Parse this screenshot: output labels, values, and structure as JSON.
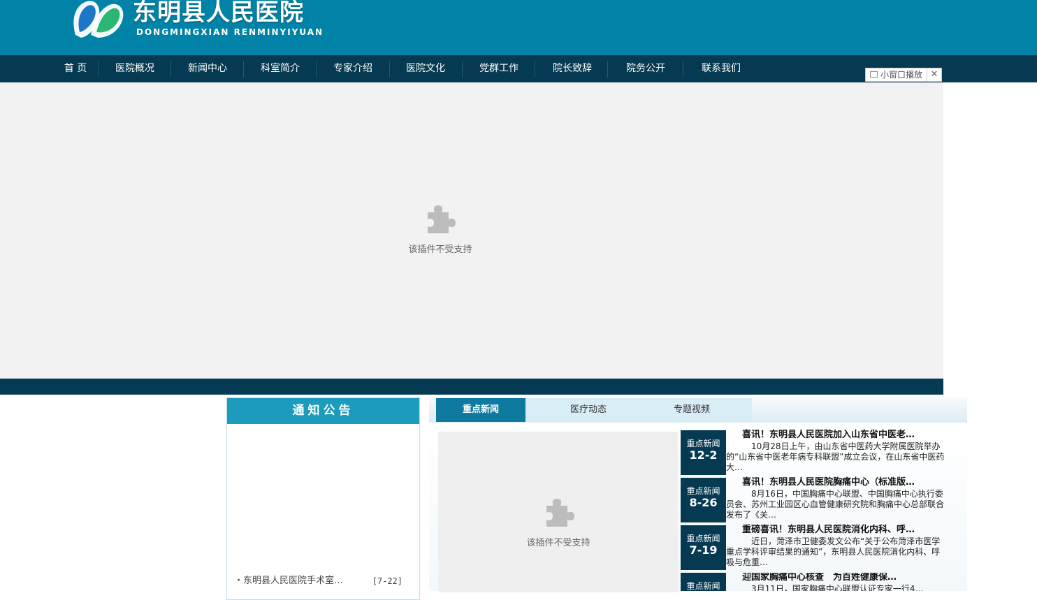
{
  "header": {
    "logo_cn": "东明县人民医院",
    "logo_en": "DONGMINGXIAN RENMINYIYUAN"
  },
  "nav": {
    "items": [
      "首 页",
      "医院概况",
      "新闻中心",
      "科室简介",
      "专家介绍",
      "医院文化",
      "党群工作",
      "院长致辞",
      "院务公开",
      "联系我们"
    ]
  },
  "mini_player": {
    "label": "小窗口播放",
    "close": "✕"
  },
  "banner": {
    "plugin_message": "该插件不受支持"
  },
  "notice": {
    "title": "通知公告",
    "items": [
      {
        "text": "・东明县人民医院手术室…",
        "date": "[7-22]"
      }
    ]
  },
  "news": {
    "tabs": [
      "重点新闻",
      "医疗动态",
      "专题视频"
    ],
    "video_plugin_message": "该插件不受支持",
    "items": [
      {
        "category": "重点新闻",
        "date": "12-2",
        "title": "喜讯！东明县人民医院加入山东省中医老…",
        "summary": "10月28日上午，由山东省中医药大学附属医院举办的“山东省中医老年病专科联盟”成立会议，在山东省中医药大…"
      },
      {
        "category": "重点新闻",
        "date": "8-26",
        "title": "喜讯！东明县人民医院胸痛中心（标准版…",
        "summary": "8月16日，中国胸痛中心联盟、中国胸痛中心执行委员会、苏州工业园区心血管健康研究院和胸痛中心总部联合发布了《关…"
      },
      {
        "category": "重点新闻",
        "date": "7-19",
        "title": "重磅喜讯！东明县人民医院消化内科、呼…",
        "summary": "近日，菏泽市卫健委发文公布“关于公布菏泽市医学重点学科评审结果的通知”，东明县人民医院消化内科、呼吸与危重…"
      },
      {
        "category": "重点新闻",
        "date": "",
        "title": "迎国家胸痛中心核查　为百姓健康保…",
        "summary": "3月11日，国家胸痛中心联盟认证专家一行4…"
      }
    ]
  },
  "colors": {
    "header_blue": "#0083a7",
    "nav_dark": "#053a52",
    "notice_head": "#1c9bbd",
    "tab_active": "#0f7aa0"
  }
}
